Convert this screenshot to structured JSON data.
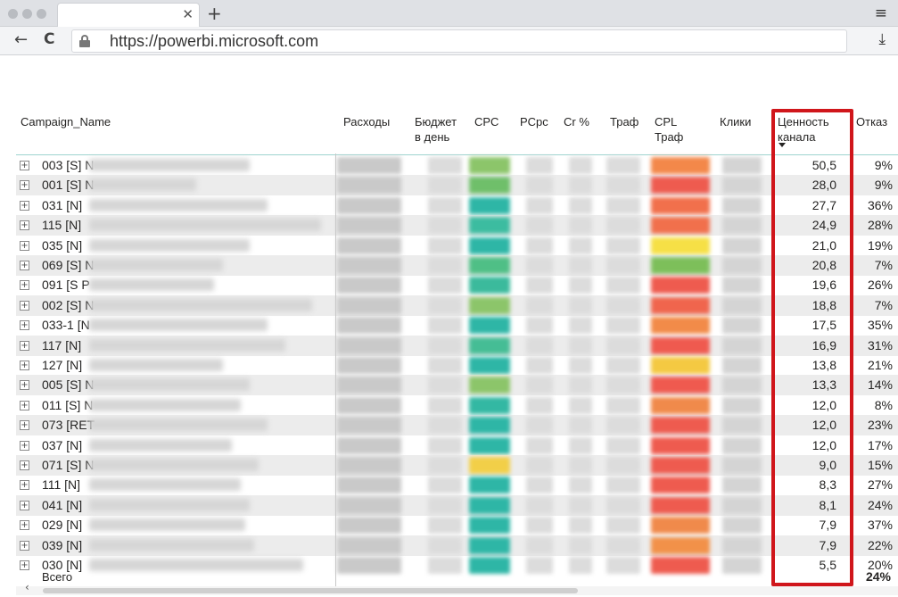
{
  "browser": {
    "url": "https://powerbi.microsoft.com",
    "close_tab_glyph": "✕",
    "new_tab_glyph": "+",
    "menu_glyph": "≡",
    "back_glyph": "←",
    "reload_glyph": "C",
    "download_glyph": "⤓"
  },
  "table": {
    "columns": {
      "campaign": "Campaign_Name",
      "expenses": "Расходы",
      "budget": "Бюджет\nв день",
      "cpc": "CPC",
      "pcpc": "PCpc",
      "cr": "Cr %",
      "traffic": "Траф",
      "cpl": "CPL\nТраф",
      "clicks": "Клики",
      "value": "Ценность\nканала",
      "bounce": "Отказ"
    },
    "rows": [
      {
        "campaign": "003 [S] N",
        "value": "50,5",
        "bounce": "9%"
      },
      {
        "campaign": "001 [S] N",
        "value": "28,0",
        "bounce": "9%"
      },
      {
        "campaign": "031 [N]",
        "value": "27,7",
        "bounce": "36%"
      },
      {
        "campaign": "115 [N]",
        "value": "24,9",
        "bounce": "28%"
      },
      {
        "campaign": "035 [N]",
        "value": "21,0",
        "bounce": "19%"
      },
      {
        "campaign": "069 [S] N",
        "value": "20,8",
        "bounce": "7%"
      },
      {
        "campaign": "091 [S P",
        "value": "19,6",
        "bounce": "26%"
      },
      {
        "campaign": "002 [S] N",
        "value": "18,8",
        "bounce": "7%"
      },
      {
        "campaign": "033-1 [N",
        "value": "17,5",
        "bounce": "35%"
      },
      {
        "campaign": "117 [N]",
        "value": "16,9",
        "bounce": "31%"
      },
      {
        "campaign": "127 [N]",
        "value": "13,8",
        "bounce": "21%"
      },
      {
        "campaign": "005 [S] N",
        "value": "13,3",
        "bounce": "14%"
      },
      {
        "campaign": "011 [S] N",
        "value": "12,0",
        "bounce": "8%"
      },
      {
        "campaign": "073 [RET",
        "value": "12,0",
        "bounce": "23%"
      },
      {
        "campaign": "037 [N]",
        "value": "12,0",
        "bounce": "17%"
      },
      {
        "campaign": "071 [S] N",
        "value": "9,0",
        "bounce": "15%"
      },
      {
        "campaign": "111 [N]",
        "value": "8,3",
        "bounce": "27%"
      },
      {
        "campaign": "041 [N]",
        "value": "8,1",
        "bounce": "24%"
      },
      {
        "campaign": "029 [N]",
        "value": "7,9",
        "bounce": "37%"
      },
      {
        "campaign": "039 [N]",
        "value": "7,9",
        "bounce": "22%"
      },
      {
        "campaign": "030 [N]",
        "value": "5,5",
        "bounce": "20%"
      }
    ],
    "cpc_colors": [
      "#8cc56a",
      "#6fbf6a",
      "#2eb6a6",
      "#3cbca0",
      "#2eb6a6",
      "#4fbf86",
      "#3bba9c",
      "#8cc56a",
      "#2eb6a6",
      "#45bd95",
      "#2eb6a6",
      "#8cc56a",
      "#33b8a3",
      "#2eb6a6",
      "#2eb6a6",
      "#f2cf48",
      "#2eb6a6",
      "#2eb6a6",
      "#2eb6a6",
      "#2eb6a6",
      "#2eb6a6"
    ],
    "cpl_colors": [
      "#f3884a",
      "#ee5b4f",
      "#f1704c",
      "#f1704c",
      "#f6e046",
      "#7dbf5a",
      "#ee5b4f",
      "#f0654d",
      "#f28b49",
      "#ef5a4f",
      "#f4c942",
      "#ef5a4f",
      "#f08a4b",
      "#ee5b4f",
      "#ee5b4f",
      "#ee5b4f",
      "#ee5b4f",
      "#ee5b4f",
      "#f08a4b",
      "#f29149",
      "#ee5b4f"
    ],
    "total_label": "Всего",
    "total_bounce": "24%"
  }
}
